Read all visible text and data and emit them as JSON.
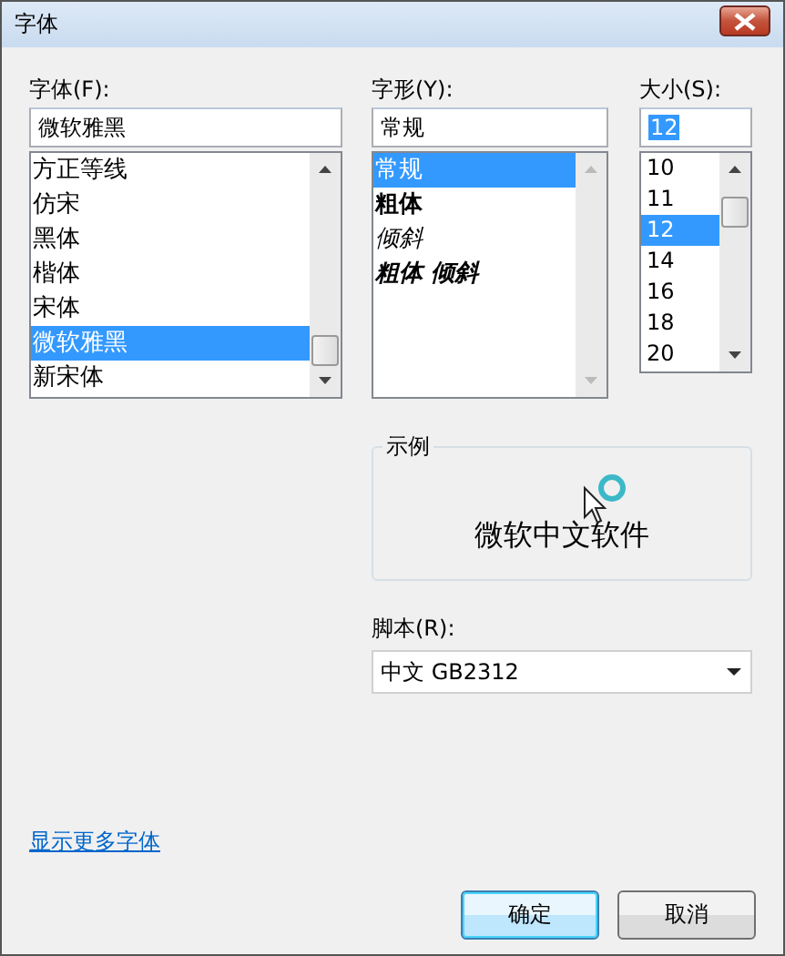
{
  "window": {
    "title": "字体"
  },
  "font": {
    "label": "字体(F):",
    "value": "微软雅黑",
    "items": [
      {
        "name": "方正等线",
        "selected": false
      },
      {
        "name": "仿宋",
        "selected": false
      },
      {
        "name": "黑体",
        "selected": false
      },
      {
        "name": "楷体",
        "selected": false
      },
      {
        "name": "宋体",
        "selected": false
      },
      {
        "name": "微软雅黑",
        "selected": true
      },
      {
        "name": "新宋体",
        "selected": false
      }
    ]
  },
  "style": {
    "label": "字形(Y):",
    "value": "常规",
    "items": [
      {
        "name": "常规",
        "kind": "regular",
        "selected": true
      },
      {
        "name": "粗体",
        "kind": "bold",
        "selected": false
      },
      {
        "name": "倾斜",
        "kind": "italic",
        "selected": false
      },
      {
        "name": "粗体 倾斜",
        "kind": "bold-italic",
        "selected": false
      }
    ]
  },
  "size": {
    "label": "大小(S):",
    "value": "12",
    "value_selected": true,
    "items": [
      {
        "name": "10",
        "selected": false
      },
      {
        "name": "11",
        "selected": false
      },
      {
        "name": "12",
        "selected": true
      },
      {
        "name": "14",
        "selected": false
      },
      {
        "name": "16",
        "selected": false
      },
      {
        "name": "18",
        "selected": false
      },
      {
        "name": "20",
        "selected": false
      }
    ]
  },
  "sample": {
    "label": "示例",
    "text": "微软中文软件"
  },
  "script": {
    "label": "脚本(R):",
    "value": "中文 GB2312"
  },
  "more_fonts_link": "显示更多字体",
  "buttons": [
    {
      "label": "确定",
      "default": true
    },
    {
      "label": "取消",
      "default": false
    }
  ]
}
